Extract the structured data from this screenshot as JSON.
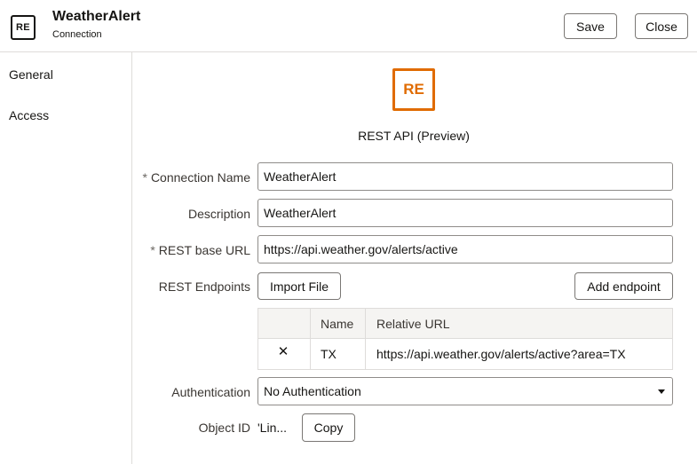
{
  "header": {
    "icon_text": "RE",
    "title": "WeatherAlert",
    "subtitle": "Connection",
    "save_label": "Save",
    "close_label": "Close"
  },
  "sidebar": {
    "items": [
      {
        "label": "General"
      },
      {
        "label": "Access"
      }
    ]
  },
  "connector": {
    "logo_text": "RE",
    "caption": "REST API (Preview)",
    "accent_color": "#e06b00"
  },
  "form": {
    "required_marker": "*",
    "connection_name": {
      "label": "Connection Name",
      "value": "WeatherAlert"
    },
    "description": {
      "label": "Description",
      "value": "WeatherAlert"
    },
    "base_url": {
      "label": "REST base URL",
      "value": "https://api.weather.gov/alerts/active"
    },
    "endpoints": {
      "label": "REST Endpoints",
      "import_label": "Import File",
      "add_label": "Add endpoint",
      "columns": [
        "",
        "Name",
        "Relative URL"
      ],
      "rows": [
        {
          "delete_icon": "close-icon",
          "delete_glyph": "✕",
          "name": "TX",
          "url": "https://api.weather.gov/alerts/active?area=TX"
        }
      ]
    },
    "authentication": {
      "label": "Authentication",
      "value": "No Authentication"
    },
    "object_id": {
      "label": "Object ID",
      "value": "'Lin...",
      "copy_label": "Copy"
    }
  }
}
